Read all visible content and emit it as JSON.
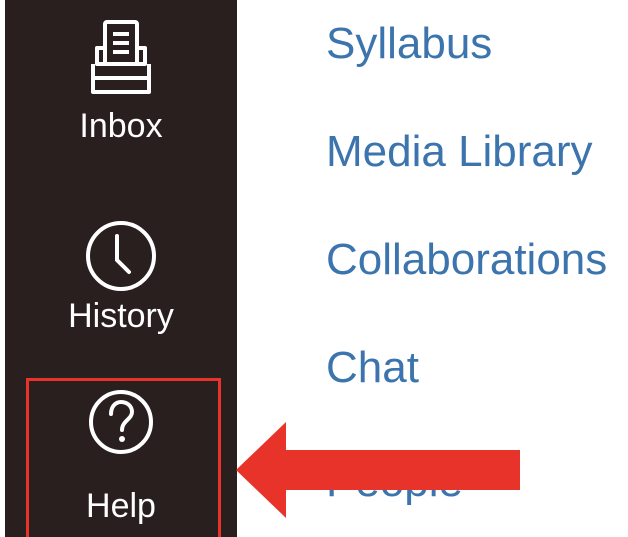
{
  "global_nav": {
    "items": [
      {
        "label": "Inbox",
        "icon": "inbox-icon"
      },
      {
        "label": "History",
        "icon": "clock-icon"
      },
      {
        "label": "Help",
        "icon": "help-question-icon"
      }
    ]
  },
  "course_nav": {
    "links": [
      {
        "label": "Syllabus"
      },
      {
        "label": "Media Library"
      },
      {
        "label": "Collaborations"
      },
      {
        "label": "Chat"
      },
      {
        "label": "People"
      }
    ]
  },
  "colors": {
    "sidebar_bg": "#2a1f1f",
    "sidebar_text": "#ffffff",
    "link": "#3c74ad",
    "annotation": "#e8332a"
  }
}
